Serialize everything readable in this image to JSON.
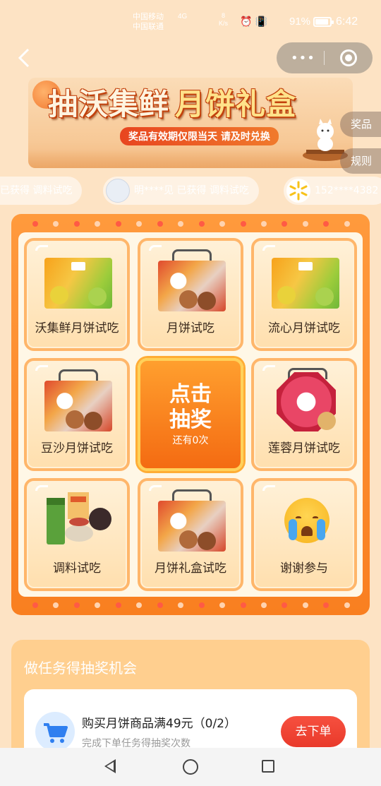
{
  "status_bar": {
    "carrier_1": "中国移动",
    "carrier_2": "中国联通",
    "network": "4G",
    "speed_value": "8",
    "speed_unit": "K/s",
    "battery_percent": "91%",
    "battery_level": 0.91,
    "time": "6:42"
  },
  "header": {
    "back_icon": "chevron-left-icon",
    "menu_icon": "more-dots-icon",
    "close_icon": "target-icon"
  },
  "banner": {
    "title_part1": "抽沃集鲜",
    "title_part2": "月饼礼盒",
    "subtitle": "奖品有效期仅限当天 请及时兑换"
  },
  "side_tabs": {
    "prizes": "奖品",
    "rules": "规则"
  },
  "winners": [
    {
      "text": "已获得 调料试吃",
      "avatar": "default"
    },
    {
      "text": "明****见 已获得 调料试吃",
      "avatar": "photo"
    },
    {
      "text": "152****4382",
      "avatar": "walmart"
    }
  ],
  "lottery": {
    "prizes": [
      {
        "label": "沃集鲜月饼试吃",
        "image": "green-gift-box"
      },
      {
        "label": "月饼试吃",
        "image": "floral-gift-box"
      },
      {
        "label": "流心月饼试吃",
        "image": "green-gift-box"
      },
      {
        "label": "豆沙月饼试吃",
        "image": "floral-gift-box"
      },
      {
        "label": "莲蓉月饼试吃",
        "image": "octagon-gift-box"
      },
      {
        "label": "调料试吃",
        "image": "seasoning-set"
      },
      {
        "label": "月饼礼盒试吃",
        "image": "floral-gift-box"
      },
      {
        "label": "谢谢参与",
        "image": "crying-face-emoji"
      }
    ],
    "draw_button": {
      "line1": "点击",
      "line2": "抽奖",
      "remaining": "还有0次"
    }
  },
  "tasks": {
    "title": "做任务得抽奖机会",
    "items": [
      {
        "name": "购买月饼商品满49元（0/2）",
        "desc": "完成下单任务得抽奖次数",
        "button": "去下单",
        "icon": "shopping-cart-icon"
      }
    ]
  },
  "nav": {
    "back": "back-triangle-icon",
    "home": "home-circle-icon",
    "recent": "recent-square-icon"
  },
  "colors": {
    "background": "#fde3c4",
    "board": "#f97f20",
    "accent_red": "#e93a2b",
    "draw_button": "#f46b12"
  }
}
